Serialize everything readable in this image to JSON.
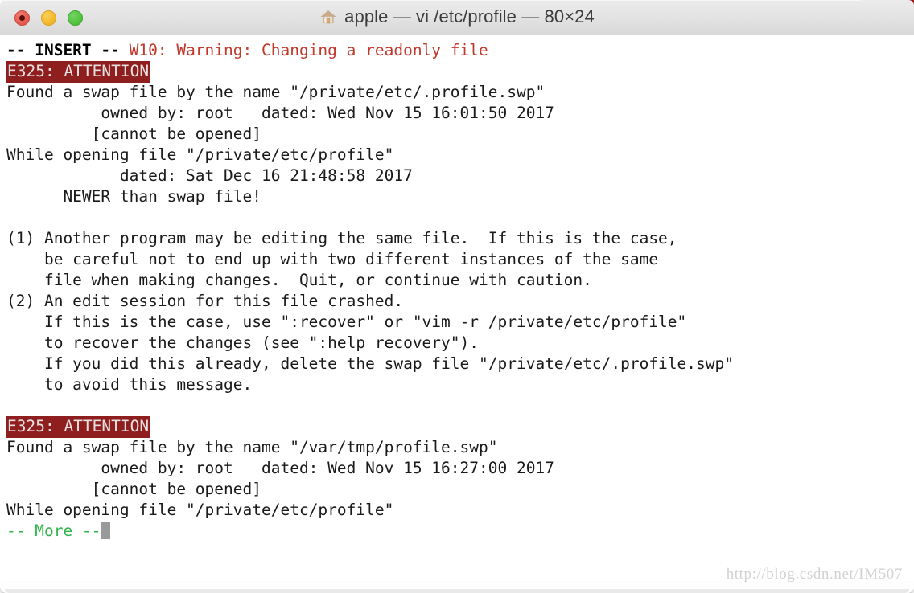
{
  "window": {
    "title": "apple — vi /etc/profile — 80×24",
    "home_icon": "home-icon",
    "traffic_lights": {
      "close_label": "Close",
      "minimize_label": "Minimize",
      "maximize_label": "Maximize"
    },
    "colors": {
      "titlebar_bg": "#e6e6e6",
      "terminal_bg": "#ffffff",
      "text_default": "#1a1a1a",
      "warning_red": "#c0392b",
      "attention_bg": "#8f1f1f",
      "attention_fg": "#e8e0e0",
      "more_green": "#2fb34a",
      "cursor": "#9a9a9a",
      "back_window_strip": "#9e1b1b"
    }
  },
  "terminal": {
    "rows": 24,
    "cols": 80,
    "lines": [
      {
        "id": "line-insert-warning",
        "segments": [
          {
            "text": "-- INSERT -- ",
            "style": "bold"
          },
          {
            "text": "W10: Warning: Changing a readonly file",
            "style": "fg-red"
          }
        ]
      },
      {
        "id": "line-attention-1",
        "segments": [
          {
            "text": "E325: ATTENTION",
            "style": "attention"
          }
        ]
      },
      {
        "id": "line-found-swap-1",
        "segments": [
          {
            "text": "Found a swap file by the name \"/private/etc/.profile.swp\"",
            "style": "fg-default"
          }
        ]
      },
      {
        "id": "line-owned-dated-1",
        "segments": [
          {
            "text": "          owned by: root   dated: Wed Nov 15 16:01:50 2017",
            "style": "fg-default"
          }
        ]
      },
      {
        "id": "line-cannot-open-1",
        "segments": [
          {
            "text": "         [cannot be opened]",
            "style": "fg-default"
          }
        ]
      },
      {
        "id": "line-while-opening-1",
        "segments": [
          {
            "text": "While opening file \"/private/etc/profile\"",
            "style": "fg-default"
          }
        ]
      },
      {
        "id": "line-dated-file-1",
        "segments": [
          {
            "text": "            dated: Sat Dec 16 21:48:58 2017",
            "style": "fg-default"
          }
        ]
      },
      {
        "id": "line-newer-than-swap",
        "segments": [
          {
            "text": "      NEWER than swap file!",
            "style": "fg-default"
          }
        ]
      },
      {
        "id": "line-blank-1",
        "segments": [
          {
            "text": "",
            "style": "fg-default"
          }
        ]
      },
      {
        "id": "line-item1-a",
        "segments": [
          {
            "text": "(1) Another program may be editing the same file.  If this is the case,",
            "style": "fg-default"
          }
        ]
      },
      {
        "id": "line-item1-b",
        "segments": [
          {
            "text": "    be careful not to end up with two different instances of the same",
            "style": "fg-default"
          }
        ]
      },
      {
        "id": "line-item1-c",
        "segments": [
          {
            "text": "    file when making changes.  Quit, or continue with caution.",
            "style": "fg-default"
          }
        ]
      },
      {
        "id": "line-item2-a",
        "segments": [
          {
            "text": "(2) An edit session for this file crashed.",
            "style": "fg-default"
          }
        ]
      },
      {
        "id": "line-item2-b",
        "segments": [
          {
            "text": "    If this is the case, use \":recover\" or \"vim -r /private/etc/profile\"",
            "style": "fg-default"
          }
        ]
      },
      {
        "id": "line-item2-c",
        "segments": [
          {
            "text": "    to recover the changes (see \":help recovery\").",
            "style": "fg-default"
          }
        ]
      },
      {
        "id": "line-item2-d",
        "segments": [
          {
            "text": "    If you did this already, delete the swap file \"/private/etc/.profile.swp\"",
            "style": "fg-default"
          }
        ]
      },
      {
        "id": "line-item2-e",
        "segments": [
          {
            "text": "    to avoid this message.",
            "style": "fg-default"
          }
        ]
      },
      {
        "id": "line-blank-2",
        "segments": [
          {
            "text": "",
            "style": "fg-default"
          }
        ]
      },
      {
        "id": "line-attention-2",
        "segments": [
          {
            "text": "E325: ATTENTION",
            "style": "attention"
          }
        ]
      },
      {
        "id": "line-found-swap-2",
        "segments": [
          {
            "text": "Found a swap file by the name \"/var/tmp/profile.swp\"",
            "style": "fg-default"
          }
        ]
      },
      {
        "id": "line-owned-dated-2",
        "segments": [
          {
            "text": "          owned by: root   dated: Wed Nov 15 16:27:00 2017",
            "style": "fg-default"
          }
        ]
      },
      {
        "id": "line-cannot-open-2",
        "segments": [
          {
            "text": "         [cannot be opened]",
            "style": "fg-default"
          }
        ]
      },
      {
        "id": "line-while-opening-2",
        "segments": [
          {
            "text": "While opening file \"/private/etc/profile\"",
            "style": "fg-default"
          }
        ]
      },
      {
        "id": "line-more-prompt",
        "segments": [
          {
            "text": "-- More --",
            "style": "fg-green"
          },
          {
            "text": "",
            "style": "cursor"
          }
        ]
      }
    ]
  },
  "watermark": {
    "text": "http://blog.csdn.net/IM507"
  }
}
